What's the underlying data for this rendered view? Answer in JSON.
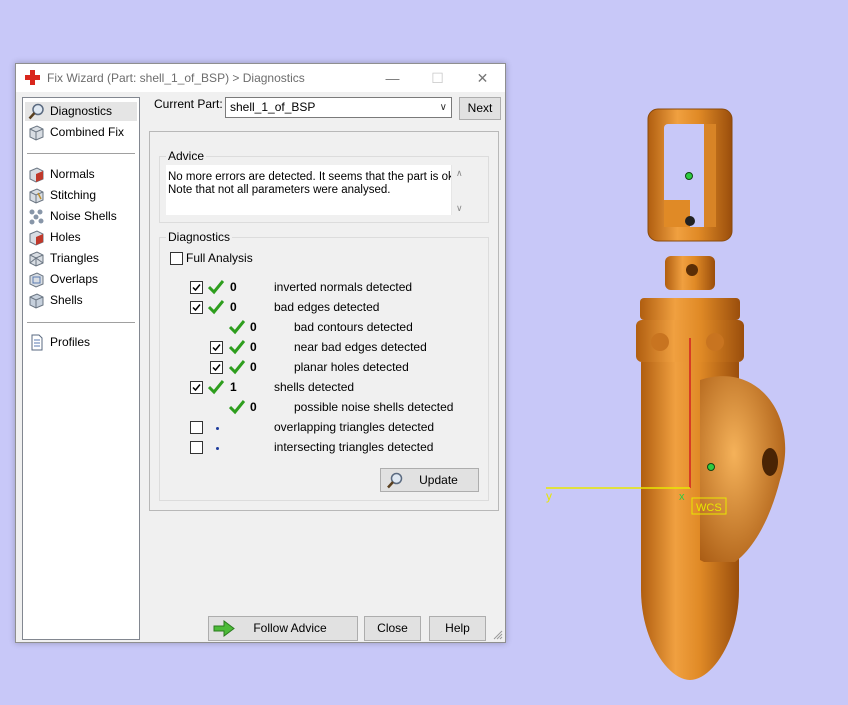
{
  "window": {
    "title": "Fix Wizard (Part: shell_1_of_BSP) > Diagnostics",
    "minimize_glyph": "—",
    "maximize_glyph": "☐",
    "close_glyph": "✕"
  },
  "nav": {
    "items": [
      {
        "label": "Diagnostics",
        "icon": "magnifier-icon"
      },
      {
        "label": "Combined Fix",
        "icon": "cube-icon"
      },
      {
        "label": "Normals",
        "icon": "normals-cube-icon"
      },
      {
        "label": "Stitching",
        "icon": "stitching-cube-icon"
      },
      {
        "label": "Noise Shells",
        "icon": "noise-shells-icon"
      },
      {
        "label": "Holes",
        "icon": "holes-cube-icon"
      },
      {
        "label": "Triangles",
        "icon": "triangles-cube-icon"
      },
      {
        "label": "Overlaps",
        "icon": "overlaps-cube-icon"
      },
      {
        "label": "Shells",
        "icon": "shells-cube-icon"
      },
      {
        "label": "Profiles",
        "icon": "profile-document-icon"
      }
    ]
  },
  "part": {
    "label": "Current Part:",
    "value": "shell_1_of_BSP",
    "next_label": "Next"
  },
  "advice": {
    "title": "Advice",
    "line1": "No more errors are detected. It seems that the part is ok.",
    "line2": "Note that not all parameters were analysed."
  },
  "diagnostics": {
    "title": "Diagnostics",
    "full_analysis": "Full Analysis",
    "rows": [
      {
        "count": "0",
        "label": "inverted normals detected",
        "checked": true
      },
      {
        "count": "0",
        "label": "bad edges detected",
        "checked": true
      },
      {
        "count": "0",
        "label": "bad contours detected"
      },
      {
        "count": "0",
        "label": "near bad edges detected",
        "checked": true
      },
      {
        "count": "0",
        "label": "planar holes detected",
        "checked": true
      },
      {
        "count": "1",
        "label": "shells detected",
        "checked": true
      },
      {
        "count": "0",
        "label": "possible noise shells detected"
      },
      {
        "count": "",
        "label": "overlapping triangles detected",
        "checked": false
      },
      {
        "count": "",
        "label": "intersecting triangles detected",
        "checked": false
      }
    ],
    "update_label": "Update"
  },
  "footer": {
    "follow_advice": "Follow Advice",
    "close": "Close",
    "help": "Help"
  },
  "scene": {
    "y_axis": "y",
    "x_axis": "x",
    "wcs": "WCS",
    "model_color": "#e08a26",
    "background": "#c8c8f8"
  }
}
